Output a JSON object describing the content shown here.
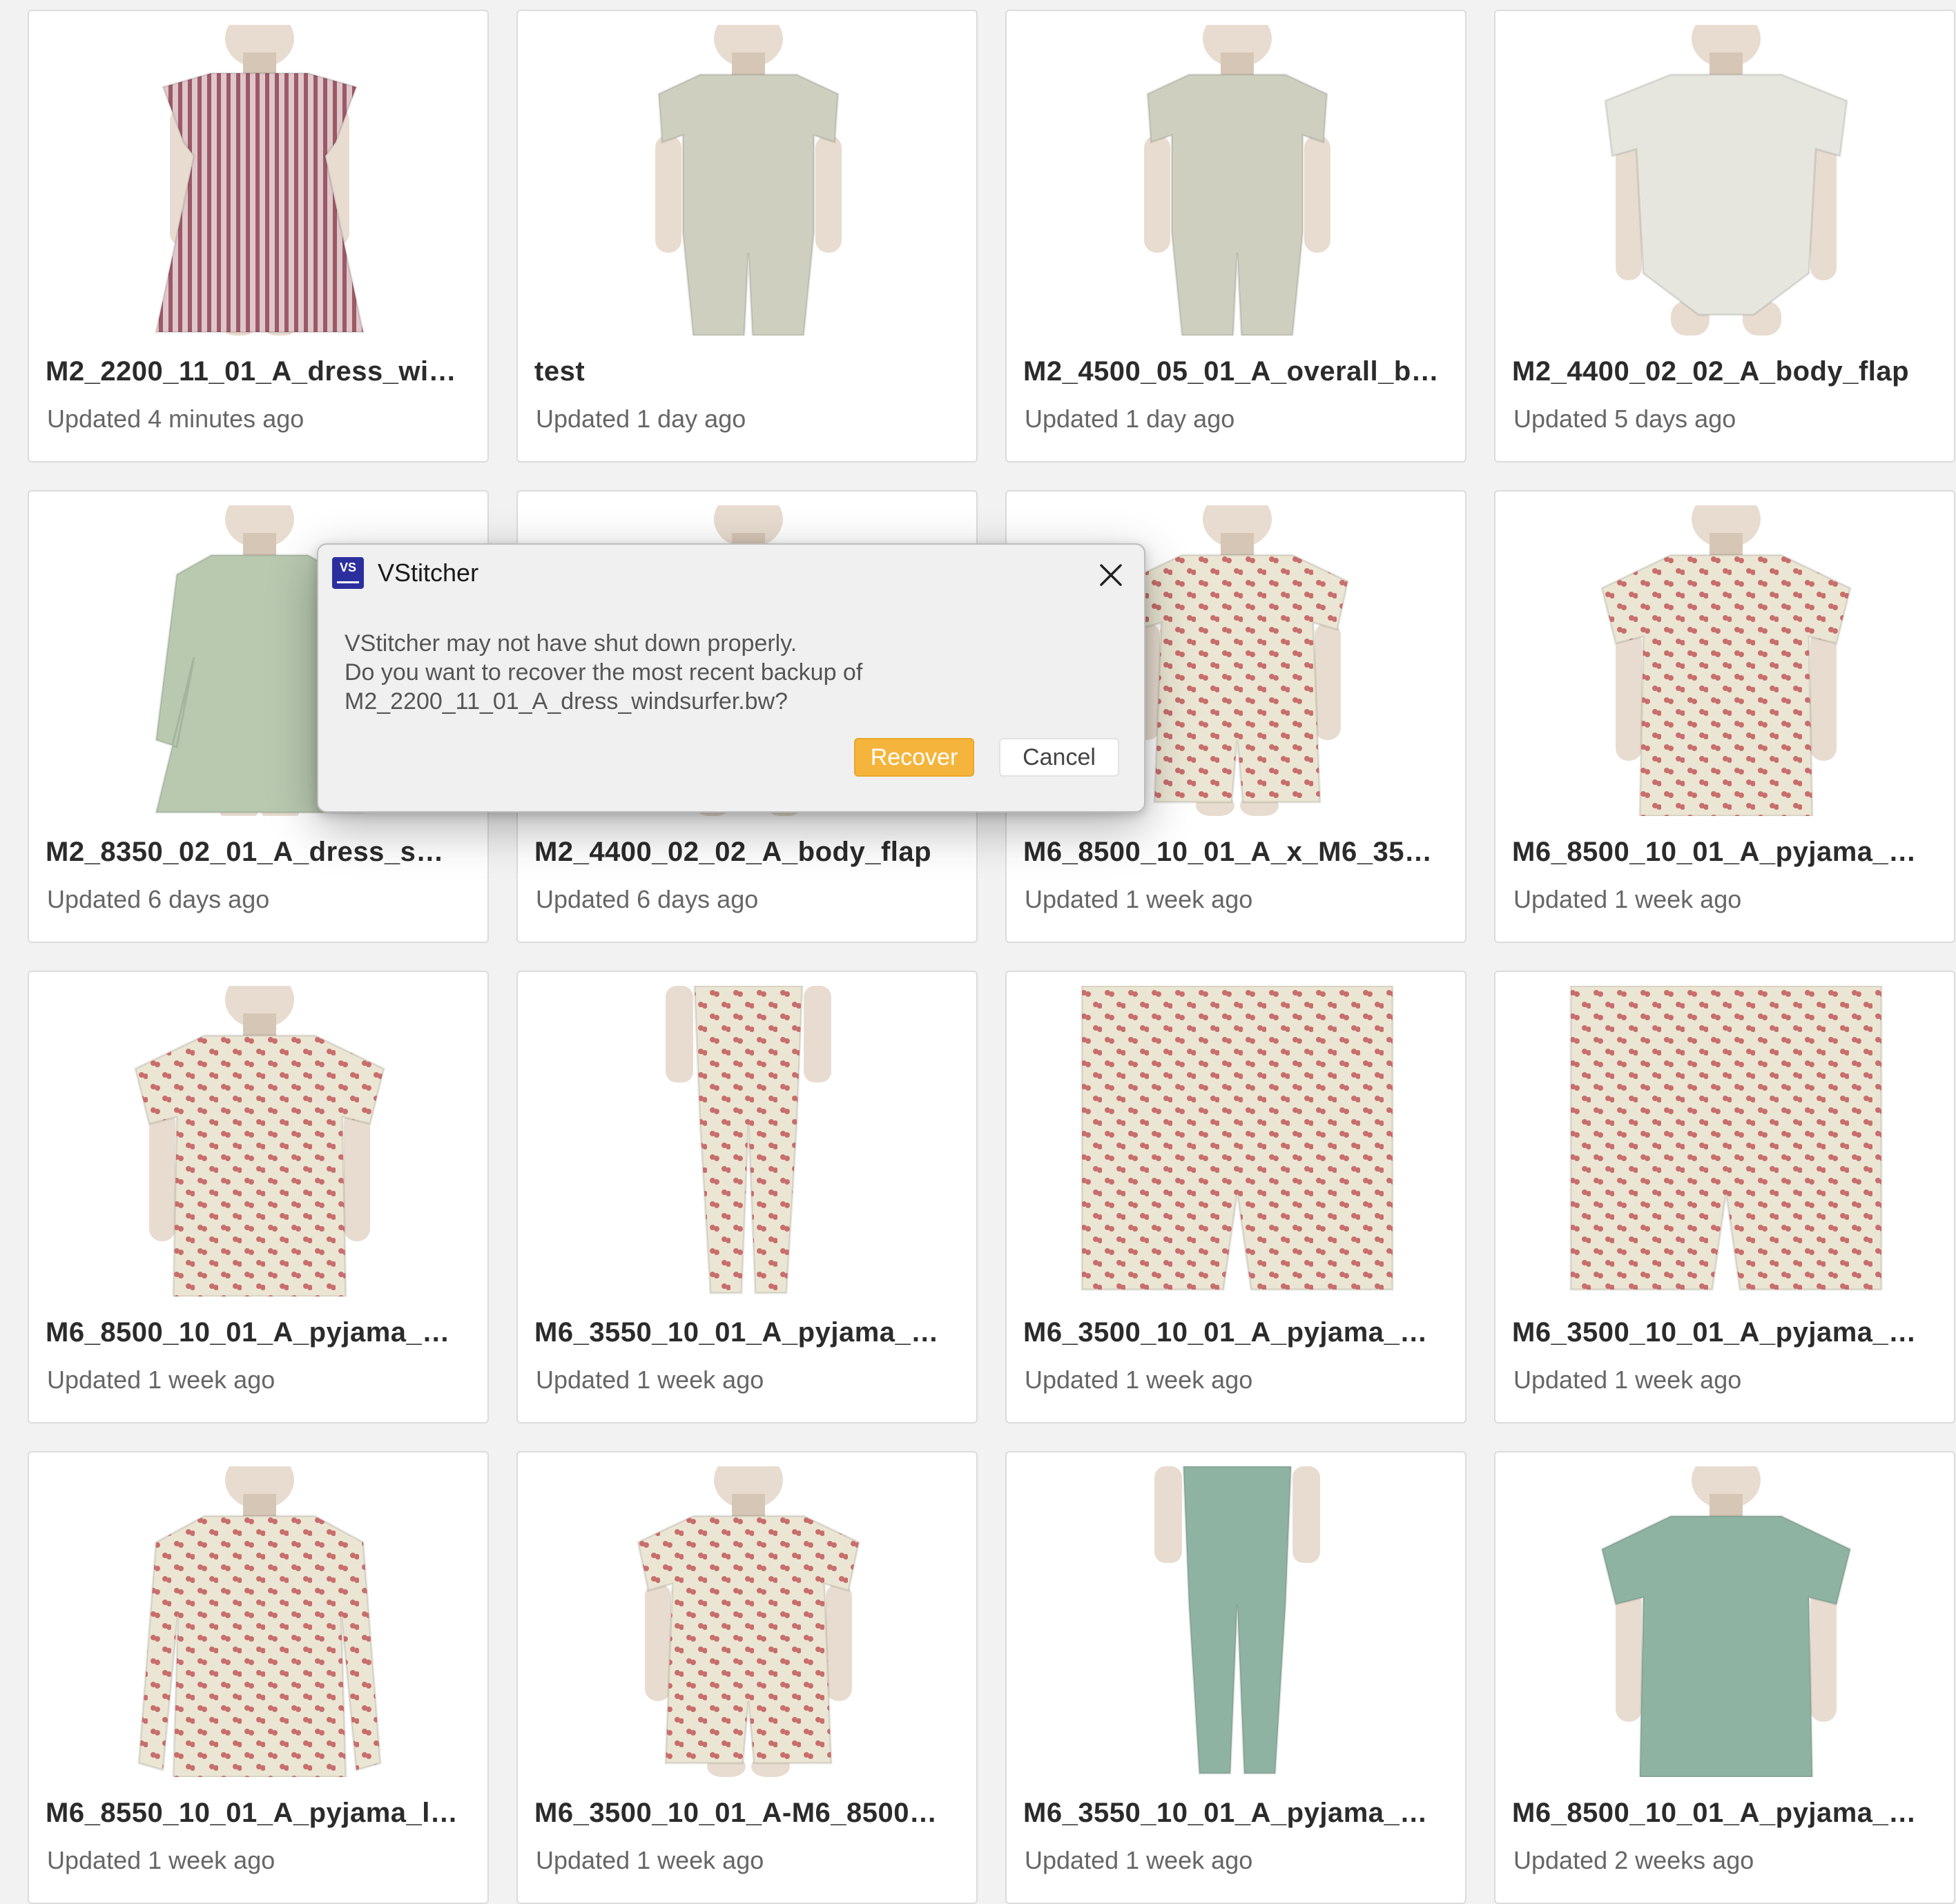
{
  "cards": [
    {
      "title": "M2_2200_11_01_A_dress_wi…",
      "updated": "Updated 4 minutes ago",
      "garment": "dress",
      "color": "#b7858d"
    },
    {
      "title": "test",
      "updated": "Updated 1 day ago",
      "garment": "overall",
      "color": "#cfcfc0"
    },
    {
      "title": "M2_4500_05_01_A_overall_b…",
      "updated": "Updated 1 day ago",
      "garment": "overall",
      "color": "#cfcfc0"
    },
    {
      "title": "M2_4400_02_02_A_body_flap",
      "updated": "Updated 5 days ago",
      "garment": "body",
      "color": "#e6e6de"
    },
    {
      "title": "M2_8350_02_01_A_dress_s…",
      "updated": "Updated 6 days ago",
      "garment": "longdress",
      "color": "#b8c9b0"
    },
    {
      "title": "M2_4400_02_02_A_body_flap",
      "updated": "Updated 6 days ago",
      "garment": "body",
      "color": "#e6e6de"
    },
    {
      "title": "M6_8500_10_01_A_x_M6_35…",
      "updated": "Updated 1 week ago",
      "garment": "set",
      "color": "#ebe6d3"
    },
    {
      "title": "M6_8500_10_01_A_pyjama_…",
      "updated": "Updated 1 week ago",
      "garment": "tee",
      "color": "#ebe6d3"
    },
    {
      "title": "M6_8500_10_01_A_pyjama_…",
      "updated": "Updated 1 week ago",
      "garment": "tee",
      "color": "#ebe6d3"
    },
    {
      "title": "M6_3550_10_01_A_pyjama_…",
      "updated": "Updated 1 week ago",
      "garment": "pants",
      "color": "#ebe6d3"
    },
    {
      "title": "M6_3500_10_01_A_pyjama_…",
      "updated": "Updated 1 week ago",
      "garment": "shorts",
      "color": "#ebe6d3"
    },
    {
      "title": "M6_3500_10_01_A_pyjama_…",
      "updated": "Updated 1 week ago",
      "garment": "shorts",
      "color": "#ebe6d3"
    },
    {
      "title": "M6_8550_10_01_A_pyjama_l…",
      "updated": "Updated 1 week ago",
      "garment": "longtee",
      "color": "#ebe6d3"
    },
    {
      "title": "M6_3500_10_01_A-M6_8500…",
      "updated": "Updated 1 week ago",
      "garment": "set",
      "color": "#ebe6d3"
    },
    {
      "title": "M6_3550_10_01_A_pyjama_…",
      "updated": "Updated 1 week ago",
      "garment": "pants",
      "color": "#8fb3a2"
    },
    {
      "title": "M6_8500_10_01_A_pyjama_…",
      "updated": "Updated 2 weeks ago",
      "garment": "tee",
      "color": "#8fb3a2"
    }
  ],
  "dialog": {
    "app_icon_text": "VS",
    "app_icon_color": "#2b2f9e",
    "title": "VStitcher",
    "close_icon": "close-icon",
    "message_lines": [
      "VStitcher may not have shut down properly.",
      "Do you want to recover the most recent backup of",
      "M2_2200_11_01_A_dress_windsurfer.bw?"
    ],
    "recover_label": "Recover",
    "cancel_label": "Cancel",
    "accent_color": "#f5b53c"
  }
}
